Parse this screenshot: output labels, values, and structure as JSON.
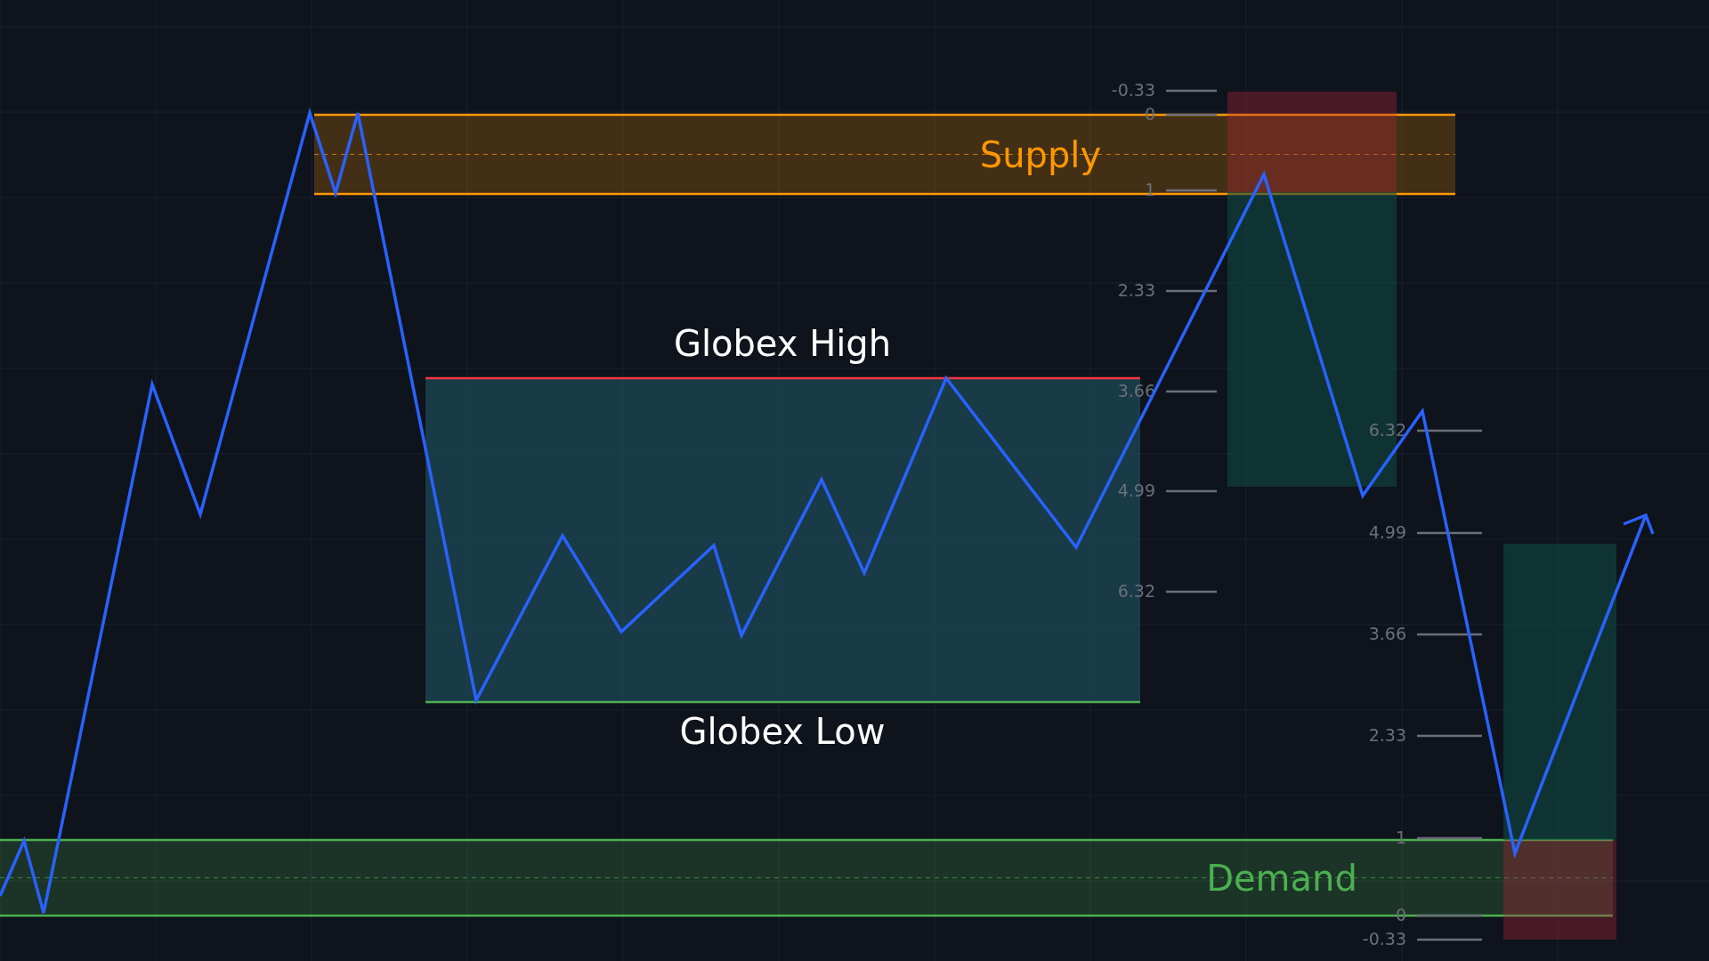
{
  "zones": [
    {
      "kind": "supply",
      "label": "Supply",
      "color": "#ff9800"
    },
    {
      "kind": "demand",
      "label": "Demand",
      "color": "#4caf50"
    }
  ],
  "range": {
    "high_label": "Globex High",
    "low_label": "Globex Low"
  },
  "fib_ladders": [
    {
      "levels": [
        "-0.33",
        "0",
        "1",
        "2.33",
        "3.66",
        "4.99",
        "6.32"
      ]
    },
    {
      "levels": [
        "6.32",
        "4.99",
        "3.66",
        "2.33",
        "1",
        "0",
        "-0.33"
      ]
    }
  ]
}
